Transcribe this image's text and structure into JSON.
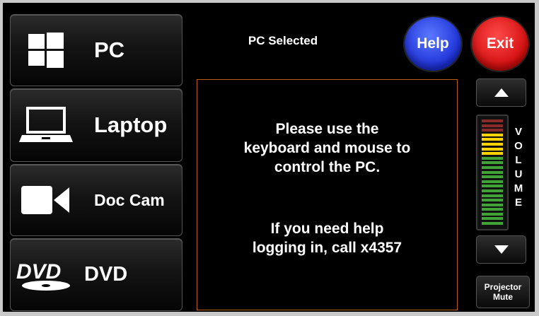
{
  "sources": [
    {
      "label": "PC",
      "icon": "windows-icon"
    },
    {
      "label": "Laptop",
      "icon": "laptop-icon"
    },
    {
      "label": "Doc Cam",
      "icon": "camera-icon"
    },
    {
      "label": "DVD",
      "icon": "dvd-logo-icon"
    }
  ],
  "status": "PC Selected",
  "help_label": "Help",
  "exit_label": "Exit",
  "message": {
    "line1": "Please use the",
    "line2": "keyboard and mouse to",
    "line3": "control the PC.",
    "line4": "If you need help",
    "line5": "logging in, call x4357"
  },
  "volume": {
    "letters": [
      "V",
      "O",
      "L",
      "U",
      "M",
      "E"
    ],
    "bar_colors": [
      "#8a2a2a",
      "#8a2a2a",
      "#8a2a2a",
      "#ffd400",
      "#ffd400",
      "#ffd400",
      "#ffd400",
      "#ffd400",
      "#3fa336",
      "#3fa336",
      "#3fa336",
      "#3fa336",
      "#3fa336",
      "#3fa336",
      "#3fa336",
      "#3fa336",
      "#3fa336",
      "#3fa336",
      "#3fa336",
      "#3fa336",
      "#3fa336",
      "#3fa336",
      "#3fa336"
    ],
    "up_icon": "up-arrow-icon",
    "down_icon": "down-arrow-icon"
  },
  "projector_mute": {
    "line1": "Projector",
    "line2": "Mute"
  },
  "colors": {
    "help": "#2b45f0",
    "exit": "#e01414",
    "message_border": "#b85c14"
  }
}
